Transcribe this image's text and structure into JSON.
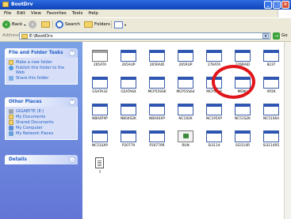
{
  "window": {
    "title": "BootDrv"
  },
  "menu": [
    "File",
    "Edit",
    "View",
    "Favorites",
    "Tools",
    "Help"
  ],
  "toolbar": {
    "back_label": "Back",
    "search_label": "Search",
    "folders_label": "Folders"
  },
  "address": {
    "label": "Address",
    "path": "E:\\BootDrv",
    "go_label": "Go"
  },
  "left_panel": {
    "file_folder_tasks": {
      "header": "File and Folder Tasks",
      "items": [
        "Make a new folder",
        "Publish this folder to the Web",
        "Share this folder"
      ]
    },
    "other_places": {
      "header": "Other Places",
      "items": [
        "GIGABYTE (E:)",
        "My Documents",
        "Shared Documents",
        "My Computer",
        "My Network Places"
      ]
    },
    "details": {
      "header": "Details"
    }
  },
  "files": [
    "265ATA",
    "265AUP",
    "265RAID",
    "265RUP",
    "276ATA",
    "276RAID",
    "823T",
    "G5ATA32",
    "G5ATA64",
    "MCP55SSK",
    "MCP55S64",
    "MCP55_P",
    "MENU",
    "XP2K",
    "NB04PXP",
    "NB04S2K",
    "NB04SXP",
    "NC192K",
    "NC195XP",
    "NC51S2K",
    "NC51S64",
    "NC51SXP",
    "P20779",
    "P20779R",
    "RUN",
    "SI3114",
    "SI3114R",
    "SI3114R5",
    "Y"
  ],
  "colors": {
    "titlebar": "#1a52c9",
    "taskpane": "#6d8fe0",
    "highlight_circle": "#e0141a"
  }
}
